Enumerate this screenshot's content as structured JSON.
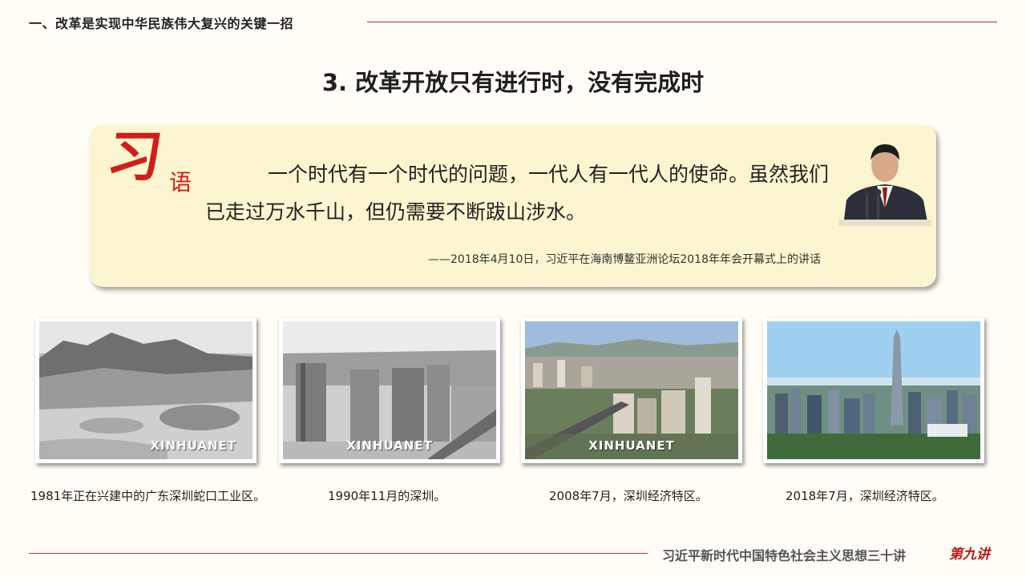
{
  "header": {
    "section_title": "一、改革是实现中华民族伟大复兴的关键一招"
  },
  "slide": {
    "title": "3. 改革开放只有进行时，没有完成时"
  },
  "quote": {
    "xi_char": "习",
    "yu_char": "语",
    "text": "一个时代有一个时代的问题，一代人有一代人的使命。虽然我们已走过万水千山，但仍需要不断跋山涉水。",
    "source": "——2018年4月10日，习近平在海南博鳌亚洲论坛2018年年会开幕式上的讲话"
  },
  "photos": [
    {
      "caption": "1981年正在兴建中的广东深圳蛇口工业区。",
      "watermark": "XINHUANET"
    },
    {
      "caption": "1990年11月的深圳。",
      "watermark": "XINHUANET"
    },
    {
      "caption": "2008年7月，深圳经济特区。",
      "watermark": "XINHUANET"
    },
    {
      "caption": "2018年7月，深圳经济特区。",
      "watermark": ""
    }
  ],
  "footer": {
    "series_title": "习近平新时代中国特色社会主义思想三十讲",
    "lecture": "第九讲"
  },
  "colors": {
    "accent_red": "#b5323a",
    "quote_bg": "#fbf6cf",
    "page_bg": "#fffdf5"
  }
}
